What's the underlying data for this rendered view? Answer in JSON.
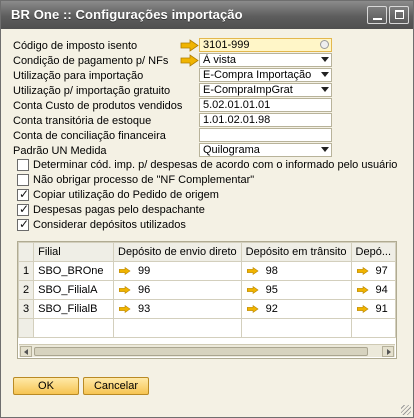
{
  "window": {
    "title": "BR One :: Configurações importação"
  },
  "form": {
    "codigo_imposto": {
      "label": "Código de imposto isento",
      "value": "3101-999"
    },
    "condicao_pagamento": {
      "label": "Condição de pagamento p/ NFs",
      "value": "À vista"
    },
    "utilizacao_importacao": {
      "label": "Utilização para importação",
      "value": "E-Compra Importação"
    },
    "utilizacao_gratuito": {
      "label": "Utilização p/ importação gratuito",
      "value": "E-CompraImpGrat"
    },
    "conta_custo": {
      "label": "Conta Custo de produtos vendidos",
      "value": "5.02.01.01.01"
    },
    "conta_transitoria": {
      "label": "Conta transitória de estoque",
      "value": "1.01.02.01.98"
    },
    "conta_conciliacao": {
      "label": "Conta de conciliação financeira",
      "value": ""
    },
    "padrao_un": {
      "label": "Padrão UN Medida",
      "value": "Quilograma"
    }
  },
  "checkboxes": [
    {
      "label": "Determinar cód. imp. p/ despesas de acordo com o informado pelo usuário",
      "checked": false
    },
    {
      "label": "Não obrigar processo de \"NF Complementar\"",
      "checked": false
    },
    {
      "label": "Copiar utilização do Pedido de origem",
      "checked": true
    },
    {
      "label": "Despesas pagas pelo despachante",
      "checked": true
    },
    {
      "label": "Considerar depósitos utilizados",
      "checked": true
    }
  ],
  "grid": {
    "headers": {
      "row": "#",
      "filial": "Filial",
      "envio": "Depósito de envio direto",
      "transito": "Depósito em trânsito",
      "extra": "Depó..."
    },
    "rows": [
      {
        "n": "1",
        "filial": "SBO_BROne",
        "envio": "99",
        "transito": "98",
        "extra": "97"
      },
      {
        "n": "2",
        "filial": "SBO_FilialA",
        "envio": "96",
        "transito": "95",
        "extra": "94"
      },
      {
        "n": "3",
        "filial": "SBO_FilialB",
        "envio": "93",
        "transito": "92",
        "extra": "91"
      }
    ]
  },
  "buttons": {
    "ok": "OK",
    "cancel": "Cancelar"
  },
  "colors": {
    "accent": "#f6c452",
    "background": "#f4f1e4",
    "titlebar": "#5d5d5d",
    "link_arrow": "#f0b400"
  },
  "icons": {
    "link_arrow": "link-arrow-icon",
    "dropdown": "chevron-down-icon"
  }
}
